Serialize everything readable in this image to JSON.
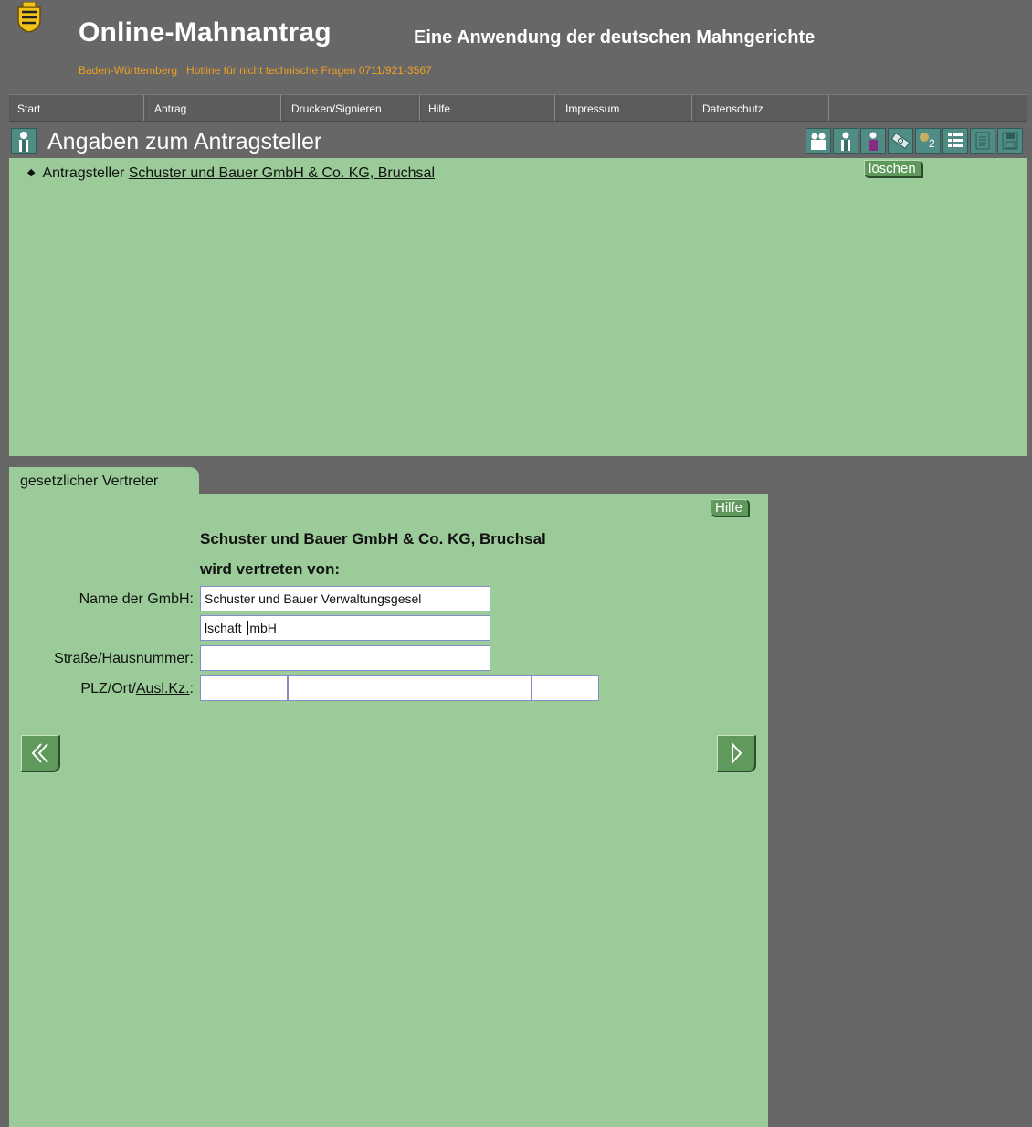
{
  "header": {
    "title": "Online-Mahnantrag",
    "subtitle": "Eine Anwendung der deutschen Mahngerichte",
    "state": "Baden-Württemberg",
    "hotline": "Hotline für nicht technische Fragen 0711/921-3567"
  },
  "menu": [
    {
      "label": "Start"
    },
    {
      "label": "Antrag"
    },
    {
      "label": "Drucken/Signieren"
    },
    {
      "label": "Hilfe"
    },
    {
      "label": "Impressum"
    },
    {
      "label": "Datenschutz"
    }
  ],
  "section": {
    "title": "Angaben zum Antragsteller",
    "tool_icons": [
      "people-icon",
      "person-icon",
      "person-purple-icon",
      "money-icon",
      "calculator-icon",
      "list-icon",
      "document-icon",
      "save-icon"
    ]
  },
  "applicant": {
    "prefix": "Antragsteller",
    "name": "Schuster und Bauer GmbH & Co. KG, Bruchsal",
    "delete_label": "löschen"
  },
  "tab": {
    "label": "gesetzlicher Vertreter"
  },
  "form": {
    "help_label": "Hilfe",
    "company": "Schuster und Bauer GmbH & Co. KG, Bruchsal",
    "represented_by": "wird vertreten von:",
    "name_label": "Name der GmbH:",
    "name_line1": "Schuster und Bauer Verwaltungsgesel",
    "name_line2_before": "lschaft ",
    "name_line2_after": "mbH",
    "street_label": "Straße/Hausnummer:",
    "street_value": "",
    "plz_label_prefix": "PLZ/Ort/",
    "plz_label_link": "Ausl.Kz.",
    "plz_label_suffix": ":",
    "plz_value": "",
    "ort_value": "",
    "kz_value": ""
  },
  "colors": {
    "background": "#676767",
    "panel_green": "#9acb98",
    "button_green": "#5f9a5c",
    "hotline_orange": "#f0a020"
  }
}
